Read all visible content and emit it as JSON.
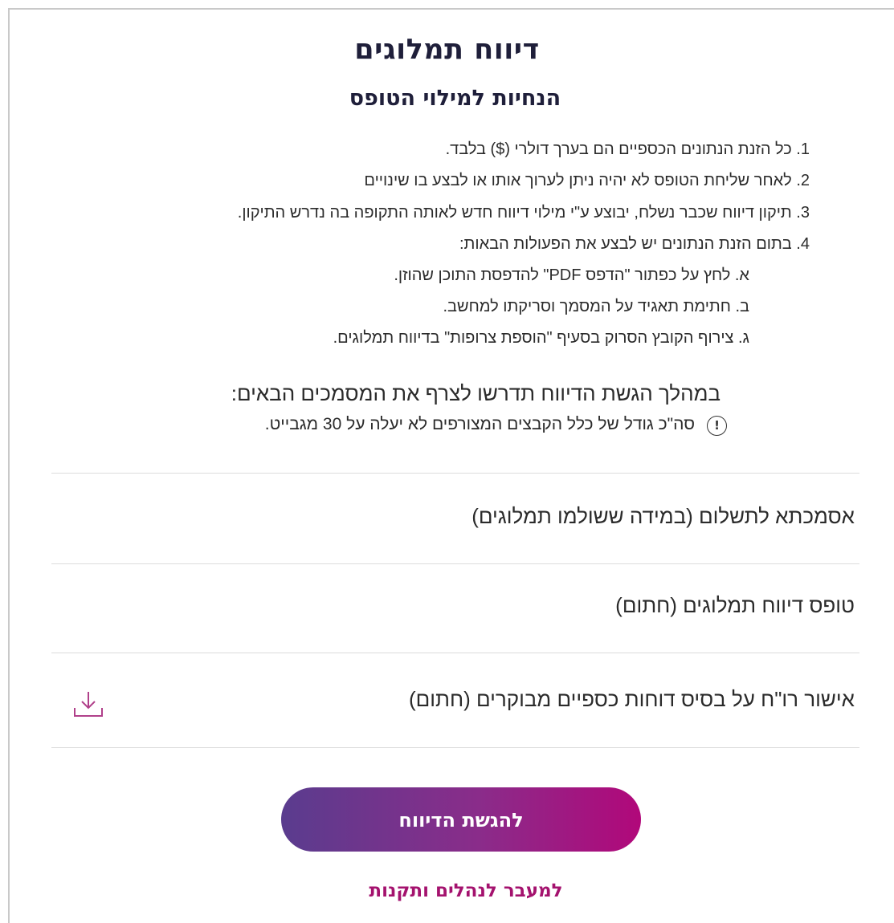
{
  "page": {
    "title": "דיווח תמלוגים",
    "subtitle": "הנחיות למילוי הטופס"
  },
  "instructions": [
    "1. כל הזנת הנתונים הכספיים הם בערך דולרי ($) בלבד.",
    "2. לאחר שליחת הטופס לא יהיה ניתן לערוך אותו או לבצע בו שינויים",
    "3. תיקון דיווח שכבר נשלח, יבוצע ע\"י מילוי דיווח חדש לאותה התקופה בה נדרש התיקון.",
    "4. בתום הזנת הנתונים יש לבצע את הפעולות הבאות:",
    "א. לחץ על כפתור \"הדפס PDF\" להדפסת התוכן שהוזן.",
    "ב. חתימת תאגיד על המסמך וסריקתו למחשב.",
    "ג. צירוף הקובץ הסרוק בסעיף \"הוספת צרופות\" בדיווח תמלוגים."
  ],
  "documents_section": {
    "title": "במהלך הגשת הדיווח תדרשו לצרף את המסמכים הבאים:",
    "note": "סה\"כ גודל של כלל הקבצים המצורפים לא יעלה על 30 מגבייט.",
    "note_icon": "info-icon",
    "items": [
      {
        "label": "אסמכתא לתשלום (במידה ששולמו תמלוגים)"
      },
      {
        "label": "טופס דיווח תמלוגים (חתום)"
      },
      {
        "label": "אישור רו\"ח על בסיס דוחות כספיים מבוקרים (חתום)",
        "icon": "download-icon"
      }
    ]
  },
  "actions": {
    "submit_label": "להגשת הדיווח",
    "link_label": "למעבר לנהלים ותקנות"
  },
  "colors": {
    "accent": "#a4126e",
    "button_gradient_start": "#5a3c8e",
    "button_gradient_end": "#b1087a",
    "icon": "#b0408a"
  }
}
